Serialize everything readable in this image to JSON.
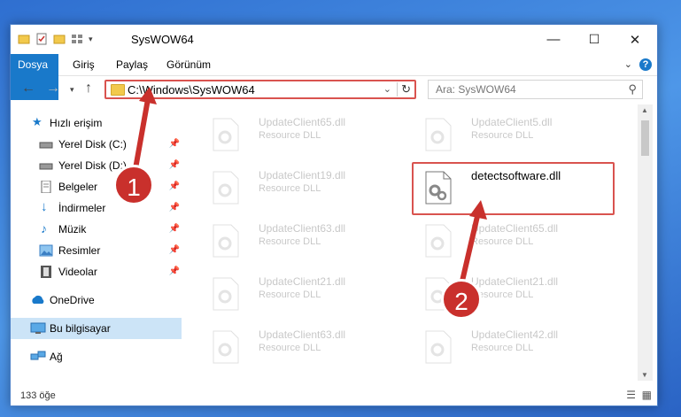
{
  "window": {
    "title": "SysWOW64",
    "controls": {
      "minimize": "—",
      "maximize": "☐",
      "close": "✕"
    }
  },
  "ribbon": {
    "tabs": [
      "Dosya",
      "Giriş",
      "Paylaş",
      "Görünüm"
    ]
  },
  "address": {
    "path": "C:\\Windows\\SysWOW64",
    "search_placeholder": "Ara: SysWOW64"
  },
  "sidebar": {
    "items": [
      {
        "label": "Hızlı erişim",
        "icon": "star-icon"
      },
      {
        "label": "Yerel Disk (C:)",
        "icon": "drive-icon"
      },
      {
        "label": "Yerel Disk (D:)",
        "icon": "drive-icon"
      },
      {
        "label": "Belgeler",
        "icon": "documents-icon"
      },
      {
        "label": "İndirmeler",
        "icon": "download-icon"
      },
      {
        "label": "Müzik",
        "icon": "music-icon"
      },
      {
        "label": "Resimler",
        "icon": "pictures-icon"
      },
      {
        "label": "Videolar",
        "icon": "videos-icon"
      },
      {
        "label": "OneDrive",
        "icon": "cloud-icon"
      },
      {
        "label": "Bu bilgisayar",
        "icon": "computer-icon"
      },
      {
        "label": "Ağ",
        "icon": "network-icon"
      }
    ]
  },
  "files": [
    {
      "name": "UpdateClient65.dll",
      "type": "Resource DLL"
    },
    {
      "name": "UpdateClient5.dll",
      "type": "Resource DLL"
    },
    {
      "name": "UpdateClient19.dll",
      "type": "Resource DLL"
    },
    {
      "name": "detectsoftware.dll",
      "type": ""
    },
    {
      "name": "UpdateClient63.dll",
      "type": "Resource DLL"
    },
    {
      "name": "UpdateClient65.dll",
      "type": "Resource DLL"
    },
    {
      "name": "UpdateClient21.dll",
      "type": "Resource DLL"
    },
    {
      "name": "UpdateClient21.dll",
      "type": "Resource DLL"
    },
    {
      "name": "UpdateClient63.dll",
      "type": "Resource DLL"
    },
    {
      "name": "UpdateClient42.dll",
      "type": "Resource DLL"
    }
  ],
  "status": {
    "count": "133 öğe"
  },
  "annotations": {
    "badge1": "1",
    "badge2": "2"
  },
  "colors": {
    "accent": "#1979ca",
    "highlight": "#d9534f",
    "badge": "#c9302c"
  }
}
